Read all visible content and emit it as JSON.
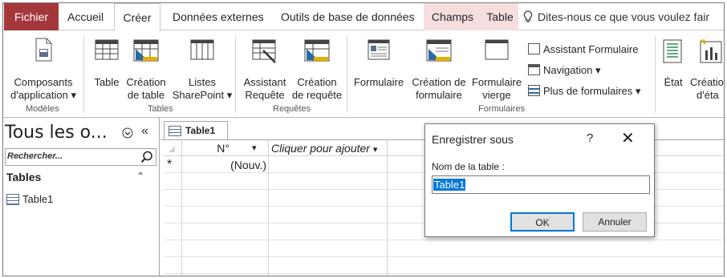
{
  "tabs": [
    {
      "label": "Fichier"
    },
    {
      "label": "Accueil"
    },
    {
      "label": "Créer"
    },
    {
      "label": "Données externes"
    },
    {
      "label": "Outils de base de données"
    },
    {
      "label": "Champs"
    },
    {
      "label": "Table"
    }
  ],
  "tell_me": "Dites-nous ce que vous voulez fair",
  "ribbon": {
    "modeles": {
      "line1": "Composants",
      "line2": "d'application",
      "group": "Modèles"
    },
    "table": {
      "label": "Table"
    },
    "creation_table": {
      "line1": "Création",
      "line2": "de table"
    },
    "listes_sharepoint": {
      "line1": "Listes",
      "line2": "SharePoint"
    },
    "tables_group": "Tables",
    "assistant_requete": {
      "line1": "Assistant",
      "line2": "Requête"
    },
    "creation_requete": {
      "line1": "Création",
      "line2": "de requête"
    },
    "requetes_group": "Requêtes",
    "formulaire": {
      "label": "Formulaire"
    },
    "creation_formulaire": {
      "line1": "Création de",
      "line2": "formulaire"
    },
    "formulaire_vierge": {
      "line1": "Formulaire",
      "line2": "vierge"
    },
    "assistant_formulaire": "Assistant Formulaire",
    "navigation": "Navigation",
    "plus_formulaires": "Plus de formulaires",
    "formulaires_group": "Formulaires",
    "etat": {
      "label": "État"
    },
    "creation_etat": {
      "line1": "Créatio",
      "line2": "d'éta"
    }
  },
  "nav": {
    "title": "Tous les o...",
    "search_placeholder": "Rechercher...",
    "group": "Tables",
    "items": [
      {
        "label": "Table1"
      }
    ]
  },
  "document": {
    "tab": "Table1",
    "columns": [
      {
        "label": "N°"
      },
      {
        "label": "Cliquer pour ajouter"
      }
    ],
    "new_row_marker": "*",
    "new_row_value": "(Nouv.)"
  },
  "dialog": {
    "title": "Enregistrer sous",
    "help": "?",
    "close": "✕",
    "field_label": "Nom de la table :",
    "field_value": "Table1",
    "ok": "OK",
    "cancel": "Annuler"
  },
  "colors": {
    "file_tab": "#a4373a",
    "context_tab": "#f6dede",
    "selection": "#0078d7"
  }
}
